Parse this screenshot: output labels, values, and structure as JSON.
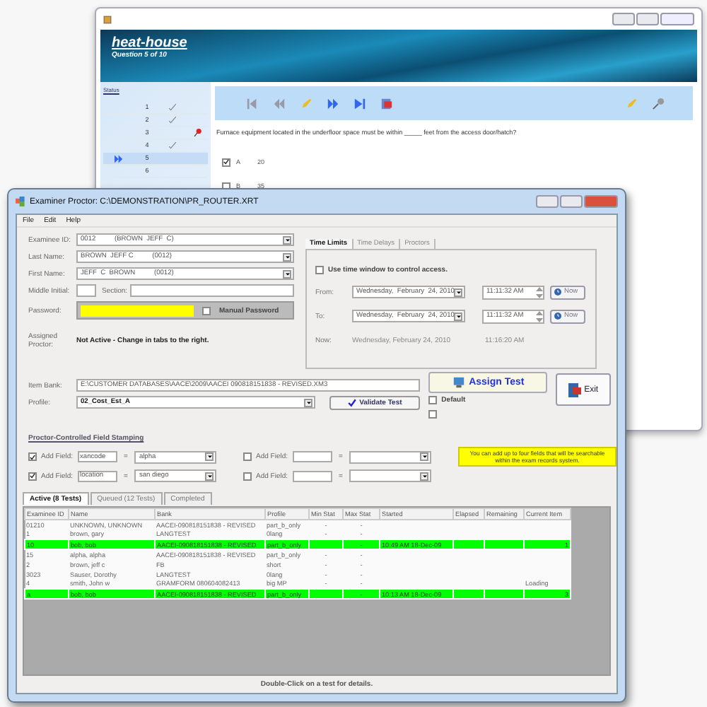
{
  "test_window": {
    "banner": {
      "title": "heat-house",
      "subtitle": "Question 5 of 10"
    },
    "status": {
      "link": "Status",
      "rows": [
        {
          "number": "1",
          "kind": "check",
          "current": false
        },
        {
          "number": "2",
          "kind": "check",
          "current": false
        },
        {
          "number": "3",
          "kind": "pin",
          "current": false
        },
        {
          "number": "4",
          "kind": "check",
          "current": false
        },
        {
          "number": "5",
          "kind": "none",
          "current": true
        },
        {
          "number": "6",
          "kind": "none",
          "current": false
        }
      ]
    },
    "question": "Furnace equipment located in the underfloor space must be within _____ feet from the access door/hatch?",
    "options": [
      {
        "letter": "A",
        "text": "20",
        "checked": true
      },
      {
        "letter": "B",
        "text": "35",
        "checked": false
      }
    ]
  },
  "proctor_window": {
    "title": "Examiner Proctor: C:\\DEMONSTRATION\\PR_ROUTER.XRT",
    "menu": [
      "File",
      "Edit",
      "Help"
    ],
    "fields": [
      {
        "label": "Examinee ID:",
        "value": "0012          (BROWN  JEFF  C)"
      },
      {
        "label": "Last Name:",
        "value": "BROWN  JEFF C          (0012)"
      },
      {
        "label": "First Name:",
        "value": "JEFF  C  BROWN          (0012)"
      }
    ],
    "middle_initial": {
      "label": "Middle Initial:"
    },
    "section": {
      "label": "Section:"
    },
    "password": {
      "label": "Password:",
      "manual_label": "Manual Password",
      "manual_checked": false
    },
    "assigned_proctor": {
      "label": "Assigned Proctor:",
      "value": "Not Active - Change in tabs to the right."
    },
    "time_tabs": [
      {
        "label": "Time Limits",
        "selected": true
      },
      {
        "label": "Time Delays",
        "selected": false
      },
      {
        "label": "Proctors",
        "selected": false
      }
    ],
    "time_window": {
      "label": "Use time window to control access.",
      "checked": false,
      "rows": [
        {
          "label": "From:",
          "date": "Wednesday,  February  24, 2010",
          "time": "11:11:32 AM",
          "button": "Now"
        },
        {
          "label": "To:",
          "date": "Wednesday,  February  24, 2010",
          "time": "11:11:32 AM",
          "button": "Now"
        }
      ],
      "now": {
        "label": "Now:",
        "date": "Wednesday, February 24, 2010",
        "time": "11:16:20 AM"
      }
    },
    "item_bank": {
      "label": "Item Bank:",
      "value": "E:\\CUSTOMER DATABASES\\AACE\\2009\\AACEI 090818151838 - REVISED.XM3"
    },
    "profile": {
      "label": "Profile:",
      "value": "02_Cost_Est_A"
    },
    "validate_button": "Validate Test",
    "assign_button": "Assign Test",
    "exit_button": "Exit",
    "default_option": {
      "label": "Default",
      "checked": false
    },
    "extra_option": {
      "checked": false
    },
    "stamping": {
      "title": "Proctor-Controlled Field Stamping",
      "fields": [
        {
          "label": "Add Field:",
          "checked": true,
          "name": "xancode",
          "separator": "=",
          "value": "alpha"
        },
        {
          "label": "Add Field:",
          "checked": false,
          "separator": "="
        },
        {
          "label": "Add Field:",
          "checked": true,
          "name": "location",
          "separator": "=",
          "value": "san diego"
        },
        {
          "label": "Add Field:",
          "checked": false,
          "separator": "="
        }
      ],
      "note": "You can add up to four fields that will be searchable within the exam records system."
    },
    "result_tabs": [
      {
        "label": "Active (8 Tests)",
        "selected": true
      },
      {
        "label": "Queued (12 Tests)",
        "selected": false
      },
      {
        "label": "Completed",
        "selected": false
      }
    ],
    "table": {
      "columns": [
        "Examinee ID",
        "Name",
        "Bank",
        "Profile",
        "Min Stat",
        "Max Stat",
        "Started",
        "Elapsed",
        "Remaining",
        "Current Item"
      ],
      "rows": [
        {
          "highlighted": false,
          "cells": [
            "01210",
            "UNKNOWN, UNKNOWN",
            "AACEI-090818151838 - REVISED",
            "part_b_only",
            "-",
            "-",
            "",
            "",
            "",
            ""
          ]
        },
        {
          "highlighted": false,
          "cells": [
            "1",
            "brown, gary",
            "LANGTEST",
            "0lang",
            "-",
            "-",
            "",
            "",
            "",
            ""
          ]
        },
        {
          "highlighted": true,
          "cells": [
            "10",
            "bob, bob",
            "AACEI-090818151838 - REVISED",
            "part_b_only",
            "",
            "-",
            "10:49 AM   18-Dec-09",
            "",
            "",
            "1"
          ]
        },
        {
          "highlighted": false,
          "cells": [
            "15",
            "alpha, alpha",
            "AACEI-090818151838 - REVISED",
            "part_b_only",
            "-",
            "-",
            "",
            "",
            "",
            ""
          ]
        },
        {
          "highlighted": false,
          "cells": [
            "2",
            "brown, jeff c",
            "FB",
            "short",
            "-",
            "-",
            "",
            "",
            "",
            ""
          ]
        },
        {
          "highlighted": false,
          "cells": [
            "3023",
            "Sauser, Dorothy",
            "LANGTEST",
            "0lang",
            "-",
            "-",
            "",
            "",
            "",
            ""
          ]
        },
        {
          "highlighted": false,
          "cells": [
            "4",
            "smith, John w",
            "GRAMFORM 080604082413",
            "big MP",
            "-",
            "-",
            "",
            "",
            "",
            "Loading"
          ]
        },
        {
          "highlighted": true,
          "cells": [
            "a",
            "bob, bob",
            "AACEI-090818151838 - REVISED",
            "part_b_only",
            "",
            "-",
            "10:13 AM   18-Dec-09",
            "",
            "",
            "3"
          ]
        }
      ]
    },
    "footer": "Double-Click on a test for details."
  }
}
